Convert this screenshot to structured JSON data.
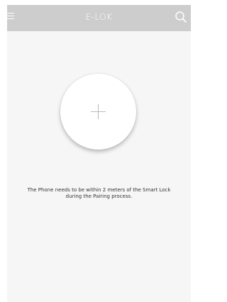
{
  "header": {
    "title": "E-LOK",
    "menu_icon": "hamburger-menu-icon",
    "search_icon": "search-icon"
  },
  "main": {
    "add_button_icon": "plus-icon",
    "instructions_line1": "The Phone needs to be within 2 meters of the Smart Lock",
    "instructions_line2": "during the Pairing process."
  },
  "colors": {
    "header_bg": "#cdcdcd",
    "screen_bg": "#f6f6f6",
    "header_text": "#ffffff",
    "plus": "#b9b9b9",
    "text": "#333333"
  }
}
